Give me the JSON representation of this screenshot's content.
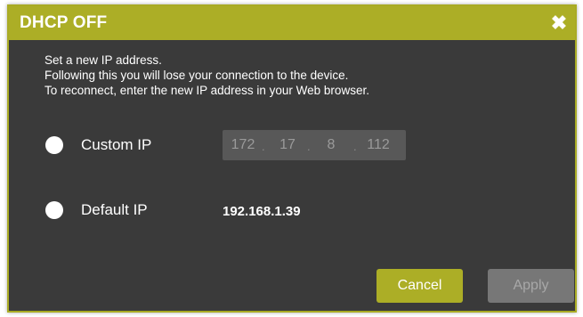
{
  "dialog": {
    "title": "DHCP OFF",
    "close_glyph": "✖",
    "close_icon": "close-icon"
  },
  "message": {
    "line1": "Set a new IP address.",
    "line2": "Following this you will lose your connection to the device.",
    "line3": "To reconnect, enter the new IP address in your Web browser."
  },
  "options": {
    "custom": {
      "label": "Custom IP",
      "octets": [
        "172",
        "17",
        "8",
        "112"
      ],
      "separator": "."
    },
    "default": {
      "label": "Default IP",
      "value": "192.168.1.39"
    }
  },
  "buttons": {
    "cancel": "Cancel",
    "apply": "Apply"
  },
  "colors": {
    "accent": "#acae26",
    "background": "#3a3a3a",
    "input_bg": "#585858",
    "disabled_button": "#777777"
  }
}
